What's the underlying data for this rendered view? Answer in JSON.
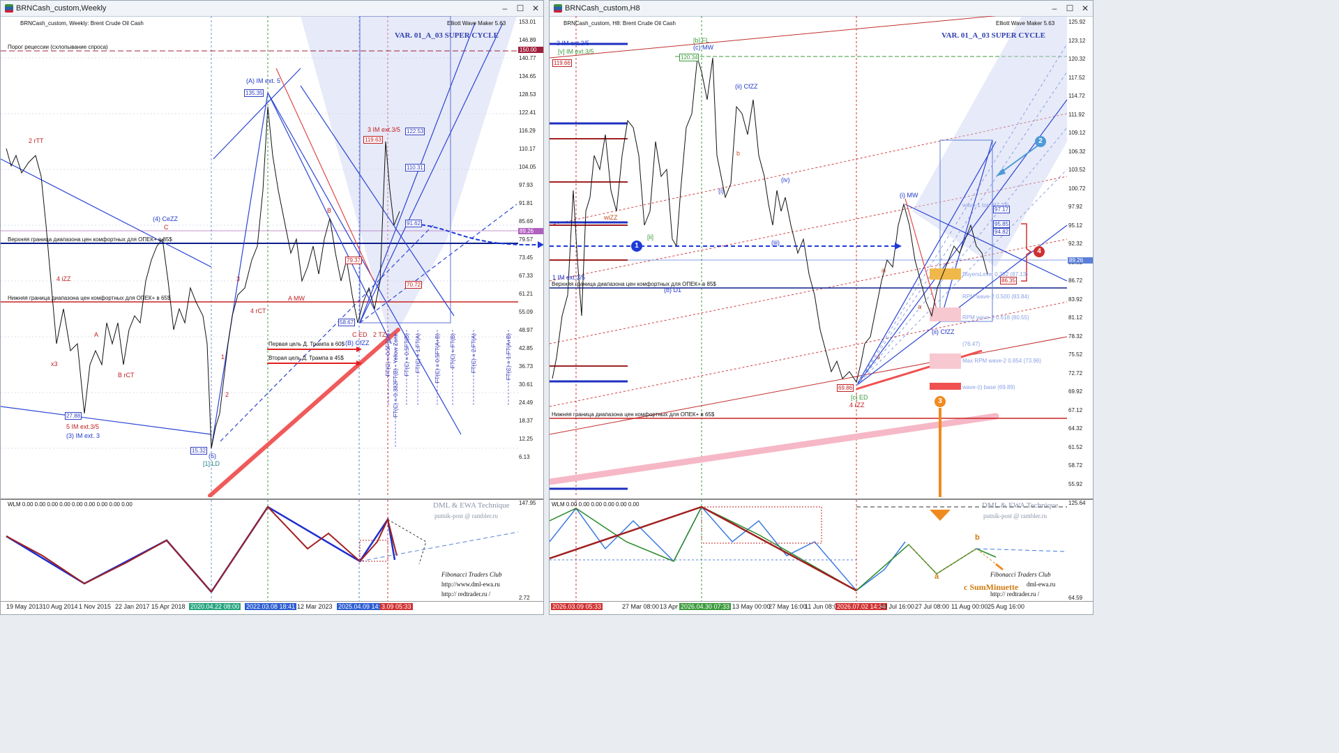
{
  "left": {
    "window_title": "BRNCash_custom,Weekly",
    "chart_header": "BRNCash_custom, Weekly:  Brent Crude Oil Cash",
    "plugin": "Elliott Wave Maker 5.63",
    "variant": "VAR. 01_A_03 SUPER CYCLE",
    "recession_label": "Порог рецессии (схлопывание спроса)",
    "upper_comfort": "Верхняя граница диапазона цен комфортных для ОПЕК+ в 85$",
    "lower_comfort": "Нижняя граница диапазона цен комфортных для ОПЕК+ в 65$",
    "trump_target1": "Первая цель Д. Трампа в 60$",
    "trump_target2": "Вторая цель Д. Трампа в 45$",
    "price_ticks": [
      "153.01",
      "146.89",
      "140.77",
      "134.65",
      "128.53",
      "122.41",
      "116.29",
      "110.17",
      "104.05",
      "97.93",
      "91.81",
      "85.69",
      "79.57",
      "73.45",
      "67.33",
      "61.21",
      "55.09",
      "48.97",
      "42.85",
      "36.73",
      "30.61",
      "24.49",
      "18.37",
      "12.25",
      "6.13"
    ],
    "price_current": "89.26",
    "price_150": "150.00",
    "price_tags": [
      "135.35",
      "122.53",
      "119.63",
      "110.31",
      "91.62",
      "79.37",
      "70.72",
      "58.67",
      "27.88",
      "15.32"
    ],
    "wave_labels": [
      "(A) IM ext. 5",
      "(4) CeZZ",
      "C",
      "2 rTT",
      "4 iZZ",
      "A",
      "B rCT",
      "x3",
      "5 IM ext.3/5",
      "(3) IM ext. 3",
      "(5)",
      "[1]:LD",
      "3 IM ext.3/5",
      "A MW",
      "B",
      "C ED",
      "(B) CfZZ",
      "2 TZ",
      "4 rCT",
      "3",
      "1",
      "2"
    ],
    "fib_labels": [
      "FT(C) = 0.5FT(A)",
      "FT(C) = 0.382FT(B) - Yellow Zone",
      "FT(C) = 0.5FT(B)",
      "FT(C) = 1.FT(A)",
      "FT(C) = 0.5FT(A+B)",
      "FT(C) = FT(B)",
      "FT(C) = 2.FT(A)",
      "FT(C) = 1.FT(A+B)"
    ],
    "osc_header": "WLM 0.00 0.00 0.00 0.00 0.00 0.00 0.00 0.00 0.00",
    "osc_ticks": [
      "147.95",
      "2.72"
    ],
    "watermark": {
      "title": "DML & EWA Technique",
      "email": "putnik-post @ rambler.ru",
      "club": "Fibonacci   Traders   Club",
      "url1": "http://www.dml-ewa.ru",
      "url2": "http://  redtrader.ru  /"
    },
    "dates": [
      "19 May 2013",
      "10 Aug 2014",
      "1 Nov 2015",
      "22 Jan 2017",
      "15 Apr 2018",
      "2020.04.22 08:00",
      "2022.03.08 18:41",
      "12 Mar 2023",
      "2025.04.09 14:46",
      "3.09 05:33"
    ]
  },
  "right": {
    "window_title": "BRNCash_custom,H8",
    "chart_header": "BRNCash_custom, H8:  Brent Crude Oil Cash",
    "plugin": "Elliott Wave Maker 5.63",
    "variant": "VAR. 01_A_03 SUPER CYCLE",
    "upper_comfort": "Верхняя граница диапазона цен комфортных для ОПЕК+ в 85$",
    "lower_comfort": "Нижняя граница диапазона цен комфортных для ОПЕК+ в 65$",
    "price_ticks": [
      "125.92",
      "123.12",
      "120.32",
      "117.52",
      "114.72",
      "111.92",
      "109.12",
      "106.32",
      "103.52",
      "100.72",
      "97.92",
      "95.12",
      "92.32",
      "89.52",
      "86.72",
      "83.92",
      "81.12",
      "78.32",
      "75.52",
      "72.72",
      "69.92",
      "67.12",
      "64.32",
      "61.52",
      "58.72",
      "55.92"
    ],
    "price_current": "89.26",
    "price_tags": [
      "119.66",
      "120.34",
      "97.17",
      "95.85",
      "94.82",
      "86.35",
      "69.86"
    ],
    "wave_labels": [
      "3 IM ext.3/5",
      "[v] IM ext.3/5",
      "[b] FL",
      "(c) MW",
      "(ii) CfZZ",
      "(iv)",
      "(iii)",
      "(i)",
      "wiZZ",
      "[ii]",
      "(b) D1",
      "1 IM ext.3/5",
      "(i) MW",
      "(ii) CfZZ",
      "[c] ED",
      "4 rZZ",
      "iii",
      "ii",
      "a",
      "b"
    ],
    "zone_labels": [
      "wave-1 top (97.23)",
      "BuyersLevel 0.382 (87.13)",
      "RPM wave-2 0.500 (83.84)",
      "RPM wave-2 0.618 (80.55)",
      "(76.47)",
      "Max RPM wave-2 0.854 (73.96)",
      "wave-(i) base (69.89)"
    ],
    "markers": [
      "1",
      "2",
      "3",
      "4"
    ],
    "osc_header": "WLM 0.00 0.00 0.00 0.00 0.00 0.00",
    "osc_ticks": [
      "125.64",
      "64.59"
    ],
    "osc_labels": {
      "a": "a",
      "b": "b",
      "c": "c SumMinuette"
    },
    "watermark": {
      "title": "DML & EWA Technique",
      "email": "putnik-post @ rambler.ru",
      "club": "Fibonacci   Traders   Club",
      "url1": "dml-ewa.ru",
      "url2": "http://  redtrader.ru  /"
    },
    "dates": [
      "2026.03.09 05:33",
      "27 Mar 08:00",
      "13 Apr 1",
      "2026.04.30 07:33",
      "13 May 00:00",
      "27 May 16:00",
      "11 Jun 08:00",
      "2026.07.02 14:34",
      "10 Jul 16:00",
      "27 Jul 08:00",
      "11 Aug 00:00",
      "25 Aug 16:00"
    ]
  }
}
